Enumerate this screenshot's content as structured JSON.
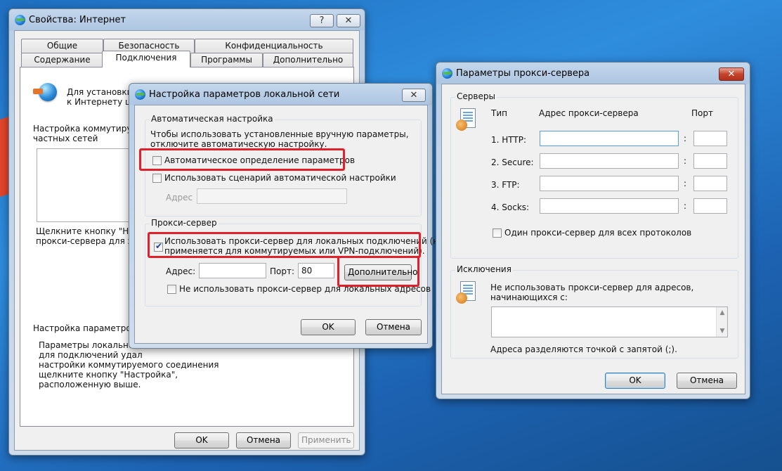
{
  "internet_properties": {
    "title": "Свойства: Интернет",
    "help_button": "?",
    "close_button": "✕",
    "tabs_row1": [
      "Общие",
      "Безопасность",
      "Конфиденциальность"
    ],
    "tabs_row2": [
      "Содержание",
      "Подключения",
      "Программы",
      "Дополнительно"
    ],
    "setup_text_line1": "Для установки п",
    "setup_text_line2": "к Интернету щ",
    "dialup_label_line1": "Настройка коммутируемо",
    "dialup_label_line2": "частных сетей",
    "proxy_hint_line1": "Щелкните кнопку \"Наст",
    "proxy_hint_line2": "прокси-сервера для это",
    "lan_label": "Настройка параметров л",
    "lan_desc": [
      "Параметры локальной с",
      "для подключений удал",
      "настройки коммутируемого соединения",
      "щелкните кнопку \"Настройка\",",
      "расположенную выше."
    ],
    "ok": "OK",
    "cancel": "Отмена",
    "apply": "Применить"
  },
  "lan_dialog": {
    "title": "Настройка параметров локальной сети",
    "close_button": "✕",
    "auto_group": "Автоматическая настройка",
    "auto_desc_line1": "Чтобы использовать установленные вручную параметры,",
    "auto_desc_line2": "отключите автоматическую настройку.",
    "auto_detect_label": "Автоматическое определение параметров",
    "auto_detect_checked": false,
    "auto_script_label": "Использовать сценарий автоматической настройки",
    "auto_script_checked": false,
    "address_label": "Адрес",
    "proxy_group": "Прокси-сервер",
    "use_proxy_label_line1": "Использовать прокси-сервер для локальных подключений (не",
    "use_proxy_label_line2": "применяется для коммутируемых или VPN-подключений).",
    "use_proxy_checked": true,
    "proxy_address_label": "Адрес:",
    "proxy_address_value": "",
    "port_label": "Порт:",
    "port_value": "80",
    "advanced_button": "Дополнительно",
    "bypass_local_label": "Не использовать прокси-сервер для локальных адресов",
    "bypass_local_checked": false,
    "ok": "OK",
    "cancel": "Отмена"
  },
  "proxy_dialog": {
    "title": "Параметры прокси-сервера",
    "close_button": "✕",
    "servers_group": "Серверы",
    "col_type": "Тип",
    "col_address": "Адрес прокси-сервера",
    "col_port": "Порт",
    "rows": [
      {
        "type": "1. HTTP:",
        "address": "",
        "port": ""
      },
      {
        "type": "2. Secure:",
        "address": "",
        "port": ""
      },
      {
        "type": "3. FTP:",
        "address": "",
        "port": ""
      },
      {
        "type": "4. Socks:",
        "address": "",
        "port": ""
      }
    ],
    "colon": ":",
    "same_proxy_label": "Один прокси-сервер для всех протоколов",
    "same_proxy_checked": false,
    "exceptions_group": "Исключения",
    "exceptions_desc_line1": "Не использовать прокси-сервер для адресов,",
    "exceptions_desc_line2": "начинающихся с:",
    "exceptions_value": "",
    "separator_hint": "Адреса разделяются точкой с запятой (;).",
    "ok": "OK",
    "cancel": "Отмена"
  },
  "colors": {
    "highlight": "#e0202a",
    "desktop": "#2f8ddd"
  }
}
